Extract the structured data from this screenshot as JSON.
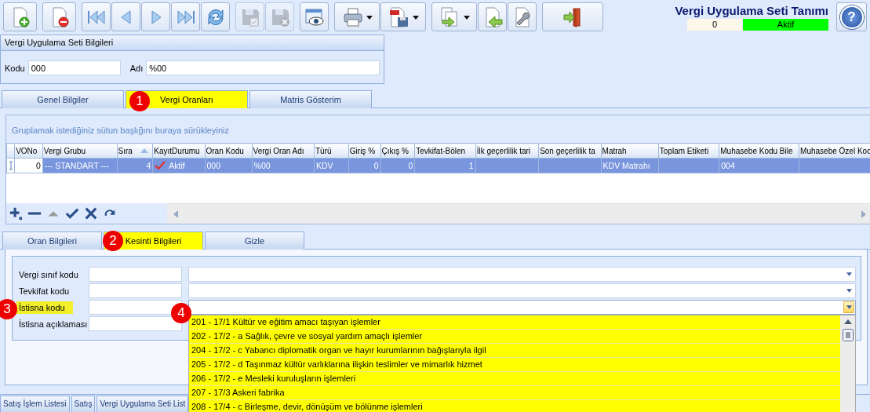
{
  "toolbar": [
    [
      {
        "kind": "new",
        "disabled": false,
        "dropdown": false
      }
    ],
    [
      {
        "kind": "delete",
        "disabled": false,
        "dropdown": false
      }
    ],
    [
      {
        "kind": "first",
        "disabled": false,
        "dropdown": false
      },
      {
        "kind": "prev",
        "disabled": false,
        "dropdown": false
      },
      {
        "kind": "next",
        "disabled": false,
        "dropdown": false
      },
      {
        "kind": "last",
        "disabled": false,
        "dropdown": false
      },
      {
        "kind": "refresh",
        "disabled": false,
        "dropdown": false
      }
    ],
    [
      {
        "kind": "save",
        "disabled": true,
        "dropdown": false
      },
      {
        "kind": "discard",
        "disabled": true,
        "dropdown": false
      }
    ],
    [
      {
        "kind": "preview",
        "disabled": false,
        "dropdown": false
      }
    ],
    [
      {
        "kind": "print",
        "disabled": false,
        "dropdown": true
      },
      {
        "kind": "pdf",
        "disabled": false,
        "dropdown": true
      }
    ],
    [
      {
        "kind": "export",
        "disabled": false,
        "dropdown": true
      },
      {
        "kind": "import",
        "disabled": false,
        "dropdown": false
      },
      {
        "kind": "tools",
        "disabled": false,
        "dropdown": false
      }
    ],
    [
      {
        "kind": "exit",
        "disabled": false,
        "dropdown": false
      }
    ]
  ],
  "header": {
    "title": "Vergi Uygulama Seti Tanımı",
    "count": "0",
    "status": "Aktif",
    "help_symbol": "?"
  },
  "set_info": {
    "title": "Vergi Uygulama Seti Bilgileri",
    "fields": [
      {
        "label": "Kodu",
        "value": "000"
      },
      {
        "label": "Adı",
        "value": "%00"
      }
    ]
  },
  "tabs": [
    {
      "label": "Genel Bilgiler",
      "selected": false
    },
    {
      "label": "Vergi Oranları",
      "selected": true,
      "badge": "1"
    },
    {
      "label": "Matris Gösterim",
      "selected": false
    }
  ],
  "grid": {
    "group_hint": "Gruplamak istediğiniz sütun başlığını buraya sürükleyiniz",
    "columns": [
      {
        "label": "VONo",
        "kind": "number"
      },
      {
        "label": "Vergi Grubu",
        "kind": "text"
      },
      {
        "label": "Sıra",
        "kind": "number",
        "sorted": true
      },
      {
        "label": "KayıtDurumu",
        "kind": "status"
      },
      {
        "label": "Oran Kodu",
        "kind": "text"
      },
      {
        "label": "Vergi Oran Adı",
        "kind": "text"
      },
      {
        "label": "Türü",
        "kind": "text"
      },
      {
        "label": "Giriş %",
        "kind": "number"
      },
      {
        "label": "Çıkış %",
        "kind": "number"
      },
      {
        "label": "Tevkifat-Bölen",
        "kind": "number"
      },
      {
        "label": "İlk geçerlilik tari",
        "kind": "text"
      },
      {
        "label": "Son geçerlilik ta",
        "kind": "text"
      },
      {
        "label": "Matrah",
        "kind": "text"
      },
      {
        "label": "Toplam Etiketi",
        "kind": "text"
      },
      {
        "label": "Muhasebe Kodu Bile",
        "kind": "text"
      },
      {
        "label": "Muhasebe Özel Kod",
        "kind": "text"
      }
    ],
    "rows": [
      {
        "selected": true,
        "cells": [
          "0",
          "--- STANDART ---",
          "4",
          "Aktif",
          "000",
          "%00",
          "KDV",
          "0",
          "0",
          "1",
          null,
          null,
          "KDV Matrahı",
          null,
          "004",
          null
        ]
      }
    ]
  },
  "nav_bar": [
    {
      "kind": "add",
      "disabled": false
    },
    {
      "kind": "remove",
      "disabled": false
    },
    {
      "kind": "up",
      "disabled": true
    },
    {
      "kind": "confirm",
      "disabled": false
    },
    {
      "kind": "cancel",
      "disabled": false
    },
    {
      "kind": "redo",
      "disabled": false
    }
  ],
  "subtabs": [
    {
      "label": "Oran Bilgileri",
      "selected": false
    },
    {
      "label": "Kesinti Bilgileri",
      "selected": true,
      "badge": "2"
    },
    {
      "label": "Gizle",
      "selected": false
    }
  ],
  "form": {
    "fields": [
      {
        "label": "Vergi sınıf kodu",
        "kind": "combo",
        "highlighted": false,
        "open": false
      },
      {
        "label": "Tevkifat kodu",
        "kind": "combo",
        "highlighted": false,
        "open": false
      },
      {
        "label": "İstisna kodu",
        "kind": "combo",
        "highlighted": true,
        "open": true,
        "badge": "3",
        "dropdown": {
          "badge": "4",
          "highlighted": true,
          "options": [
            "201 - 17/1 Kültür ve eğitim amacı taşıyan işlemler",
            "202 - 17/2 - a Sağlık, çevre ve sosyal yardım amaçlı işlemler",
            "204 - 17/2 - c Yabancı diplomatik organ ve hayır kurumlarının bağışlarıyla ilgil",
            "205 - 17/2 - d Taşınmaz kültür varlıklarına ilişkin teslimler ve mimarlık hizmet",
            "206 - 17/2 - e Mesleki kuruluşların işlemleri",
            "207 - 17/3 Askeri fabrika",
            "208 - 17/4 - c Birleşme, devir, dönüşüm ve bölünme işlemleri"
          ]
        }
      },
      {
        "label": "İstisna açıklaması",
        "kind": "text",
        "highlighted": false
      }
    ]
  },
  "bottom_tabs": [
    {
      "label": "Satış İşlem Listesi"
    },
    {
      "label": "Satış"
    },
    {
      "label": "Vergi Uygulama Seti List"
    }
  ]
}
